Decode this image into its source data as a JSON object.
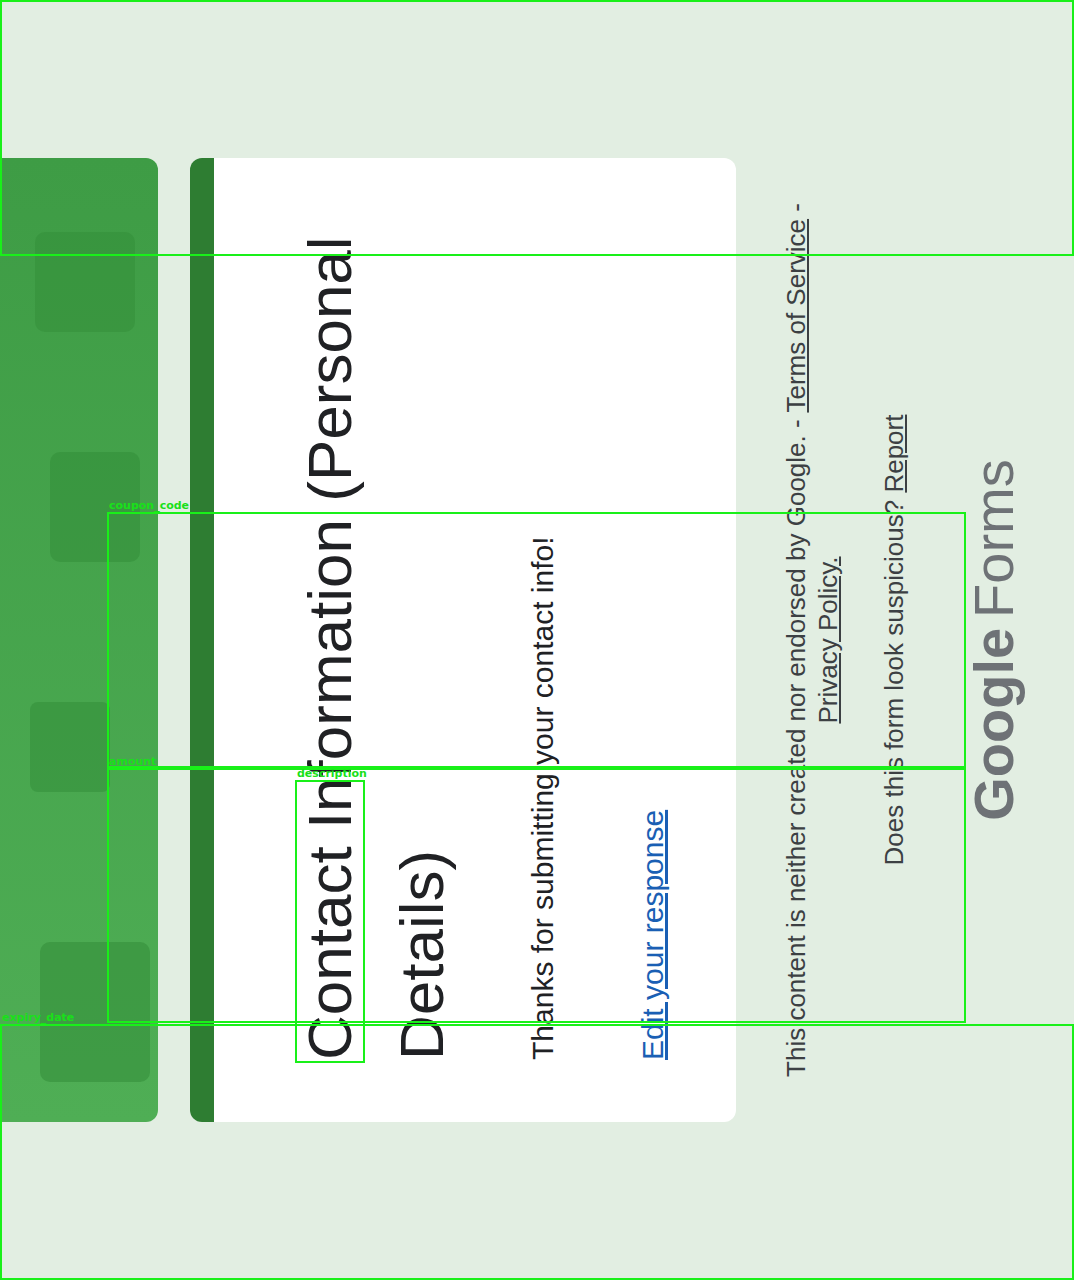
{
  "form": {
    "title": "Contact Information (Personal Details)",
    "confirmation": "Thanks for submitting your contact info!",
    "edit_link": "Edit your response"
  },
  "footer": {
    "disclaimer": "This content is neither created nor endorsed by Google.",
    "separator": "-",
    "links": [
      "Terms of Service",
      "Privacy Policy."
    ],
    "question": "Does this form look suspicious?",
    "report": "Report",
    "logo": {
      "brand": "Google",
      "product": "Forms"
    }
  },
  "annotations": [
    {
      "label": ""
    },
    {
      "label": "coupon_code"
    },
    {
      "label": "amount"
    },
    {
      "label": "description"
    },
    {
      "label": "expiry_date"
    }
  ]
}
